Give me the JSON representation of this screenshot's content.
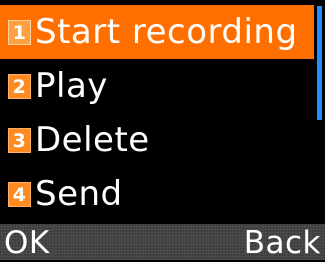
{
  "menu": {
    "items": [
      {
        "number": "1",
        "label": "Start recording",
        "selected": true
      },
      {
        "number": "2",
        "label": "Play",
        "selected": false
      },
      {
        "number": "3",
        "label": "Delete",
        "selected": false
      },
      {
        "number": "4",
        "label": "Send",
        "selected": false
      }
    ]
  },
  "softkeys": {
    "left": "OK",
    "right": "Back"
  },
  "colors": {
    "background": "#000000",
    "selection": "#ff6f00",
    "badge": "#ff8a1f",
    "scrollbar": "#1e90ff",
    "softkey_bar": "#444444",
    "text": "#ffffff"
  },
  "icons": {
    "number_badge": "numbered-square-icon"
  }
}
